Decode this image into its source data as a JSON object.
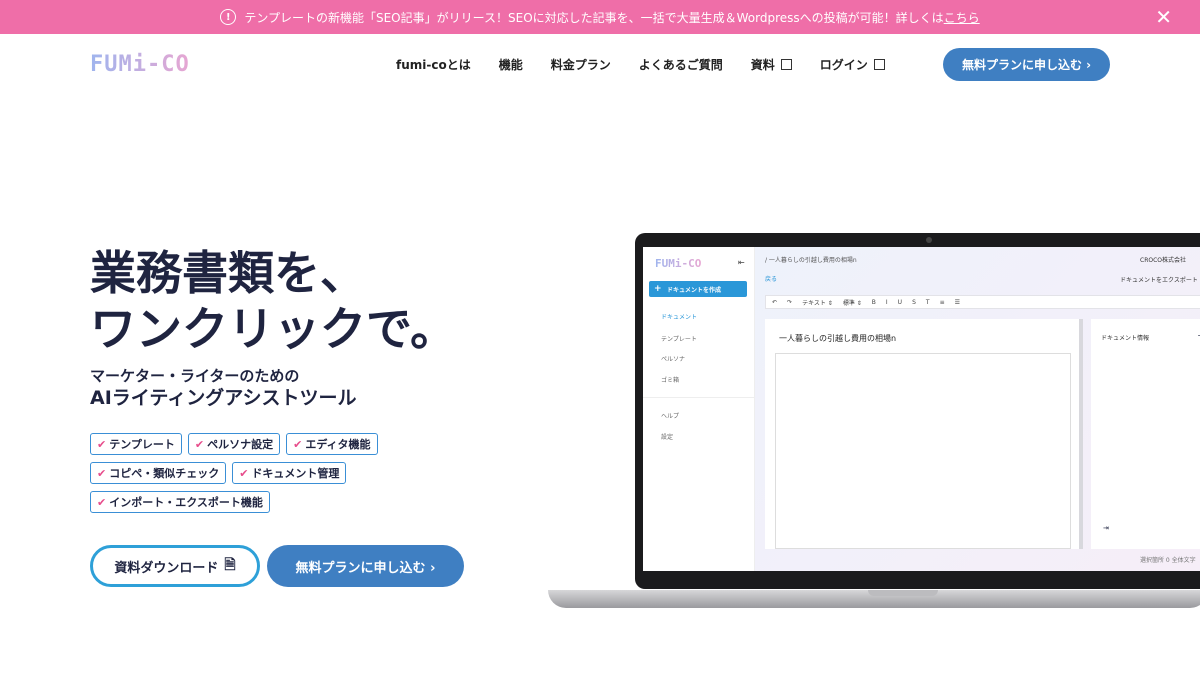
{
  "banner": {
    "text": "テンプレートの新機能「SEO記事」がリリース！SEOに対応した記事を、一括で大量生成＆Wordpressへの投稿が可能！詳しくは",
    "link": "こちら",
    "close": "✕"
  },
  "header": {
    "logo": "FUMi-CO",
    "nav": [
      "fumi-coとは",
      "機能",
      "料金プラン",
      "よくあるご質問",
      "資料",
      "ログイン"
    ],
    "cta": "無料プランに申し込む ›"
  },
  "hero": {
    "headline_line1": "業務書類を、",
    "headline_line2": "ワンクリックで。",
    "sub_line1": "マーケター・ライターのための",
    "sub_line2": "AIライティングアシストツール",
    "tags": [
      "テンプレート",
      "ペルソナ設定",
      "エディタ機能",
      "コピペ・類似チェック",
      "ドキュメント管理",
      "インポート・エクスポート機能"
    ],
    "btn_doc": "資料ダウンロード",
    "btn_free": "無料プランに申し込む ›"
  },
  "app": {
    "logo": "FUMi-CO",
    "create": "ドキュメントを作成",
    "sidebar": [
      "ドキュメント",
      "テンプレート",
      "ペルソナ",
      "ゴミ箱",
      "ヘルプ",
      "設定"
    ],
    "crumb": "/ 一人暮らしの引越し費用の相場n",
    "back": "戻る",
    "company": "CROCO株式会社",
    "export": "ドキュメントをエクスポート",
    "toolbar": [
      "↶",
      "↷",
      "テキスト ⇕",
      "標準 ⇕",
      "B",
      "I",
      "U",
      "S",
      "T",
      "≡",
      "☰"
    ],
    "doc_title": "一人暮らしの引越し費用の相場n",
    "info_title": "ドキュメント情報",
    "status": "選択箇所 0    全体文字"
  }
}
